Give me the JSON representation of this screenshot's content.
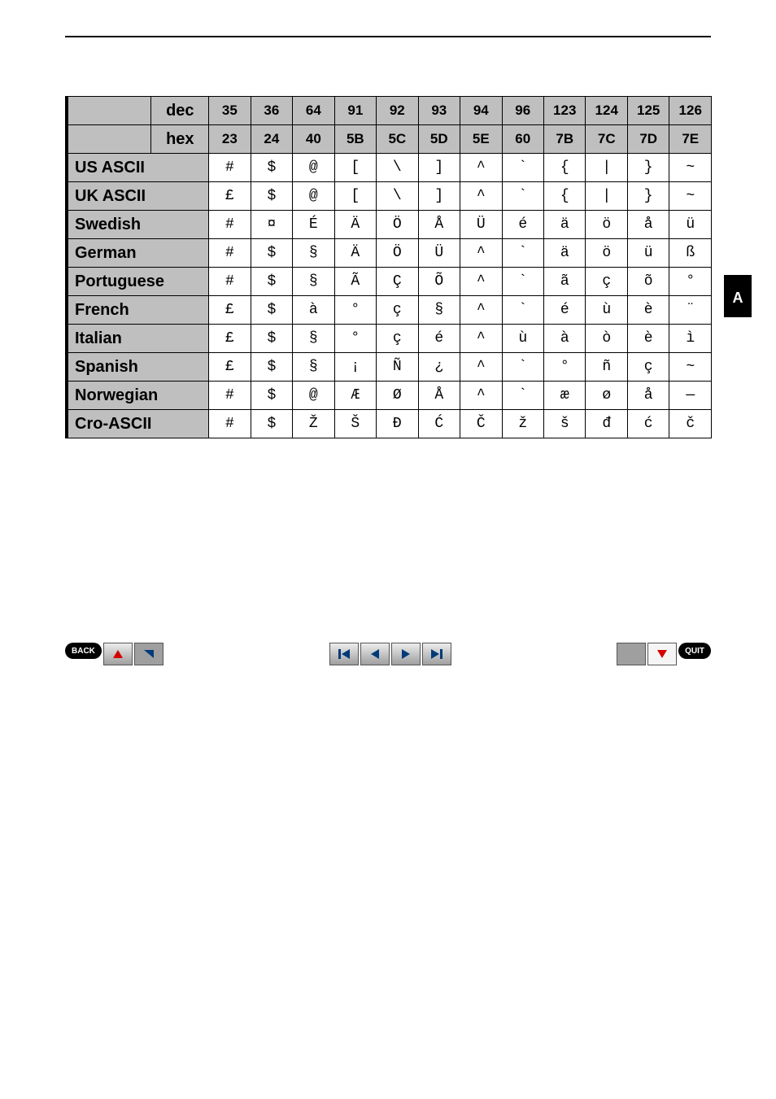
{
  "header_dec_label": "dec",
  "header_hex_label": "hex",
  "dec_cols": [
    "35",
    "36",
    "64",
    "91",
    "92",
    "93",
    "94",
    "96",
    "123",
    "124",
    "125",
    "126"
  ],
  "hex_cols": [
    "23",
    "24",
    "40",
    "5B",
    "5C",
    "5D",
    "5E",
    "60",
    "7B",
    "7C",
    "7D",
    "7E"
  ],
  "rows": [
    {
      "label": "US ASCII",
      "cells": [
        "#",
        "$",
        "@",
        "[",
        "\\",
        "]",
        "^",
        "`",
        "{",
        "|",
        "}",
        "~"
      ]
    },
    {
      "label": "UK ASCII",
      "cells": [
        "£",
        "$",
        "@",
        "[",
        "\\",
        "]",
        "^",
        "`",
        "{",
        "|",
        "}",
        "~"
      ]
    },
    {
      "label": "Swedish",
      "cells": [
        "#",
        "¤",
        "É",
        "Ä",
        "Ö",
        "Å",
        "Ü",
        "é",
        "ä",
        "ö",
        "å",
        "ü"
      ]
    },
    {
      "label": "German",
      "cells": [
        "#",
        "$",
        "§",
        "Ä",
        "Ö",
        "Ü",
        "^",
        "`",
        "ä",
        "ö",
        "ü",
        "ß"
      ]
    },
    {
      "label": "Portuguese",
      "cells": [
        "#",
        "$",
        "§",
        "Ã",
        "Ç",
        "Õ",
        "^",
        "`",
        "ã",
        "ç",
        "õ",
        "°"
      ]
    },
    {
      "label": "French",
      "cells": [
        "£",
        "$",
        "à",
        "°",
        "ç",
        "§",
        "^",
        "`",
        "é",
        "ù",
        "è",
        "¨"
      ]
    },
    {
      "label": "Italian",
      "cells": [
        "£",
        "$",
        "§",
        "°",
        "ç",
        "é",
        "^",
        "ù",
        "à",
        "ò",
        "è",
        "ì"
      ]
    },
    {
      "label": "Spanish",
      "cells": [
        "£",
        "$",
        "§",
        "¡",
        "Ñ",
        "¿",
        "^",
        "`",
        "°",
        "ñ",
        "ç",
        "~"
      ]
    },
    {
      "label": "Norwegian",
      "cells": [
        "#",
        "$",
        "@",
        "Æ",
        "Ø",
        "Å",
        "^",
        "`",
        "æ",
        "ø",
        "å",
        "—"
      ]
    },
    {
      "label": "Cro-ASCII",
      "cells": [
        "#",
        "$",
        "Ž",
        "Š",
        "Đ",
        "Ć",
        "Č",
        "ž",
        "š",
        "đ",
        "ć",
        "č"
      ]
    }
  ],
  "tab_label": "A",
  "nav": {
    "back": "BACK",
    "quit": "QUIT"
  }
}
